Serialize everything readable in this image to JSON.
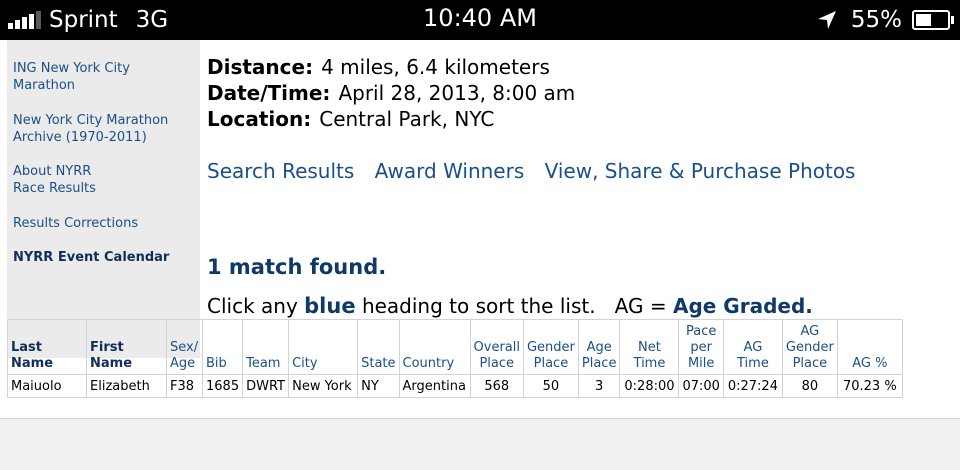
{
  "status_bar": {
    "carrier": "Sprint",
    "network": "3G",
    "time": "10:40 AM",
    "battery": "55%",
    "battery_level": 0.55
  },
  "sidebar": {
    "links": [
      "ING New York City Marathon",
      "New York City Marathon Archive (1970-2011)",
      "About NYRR Race Results",
      "Results Corrections",
      "NYRR Event Calendar"
    ]
  },
  "race_info": {
    "distance_label": "Distance:",
    "distance_value": "4 miles, 6.4 kilometers",
    "datetime_label": "Date/Time:",
    "datetime_value": "April 28, 2013, 8:00 am",
    "location_label": "Location:",
    "location_value": "Central Park, NYC"
  },
  "nav_links": {
    "search_results": "Search Results",
    "award_winners": "Award Winners",
    "photos": "View, Share & Purchase Photos"
  },
  "results": {
    "match_text": "1 match found.",
    "instructions": {
      "before": "Click any",
      "blue_word": "blue",
      "after": "heading to sort the list.",
      "ag_prefix": "AG =",
      "ag_text": "Age Graded."
    },
    "headers": [
      "Last Name",
      "First Name",
      "Sex/ Age",
      "Bib",
      "Team",
      "City",
      "State",
      "Country",
      "Overall Place",
      "Gender Place",
      "Age Place",
      "Net Time",
      "Pace per Mile",
      "AG Time",
      "AG Gender Place",
      "AG %"
    ],
    "rows": [
      [
        "Maiuolo",
        "Elizabeth",
        "F38",
        "1685",
        "DWRT",
        "New York",
        "NY",
        "Argentina",
        "568",
        "50",
        "3",
        "0:28:00",
        "07:00",
        "0:27:24",
        "80",
        "70.23 %"
      ]
    ]
  }
}
